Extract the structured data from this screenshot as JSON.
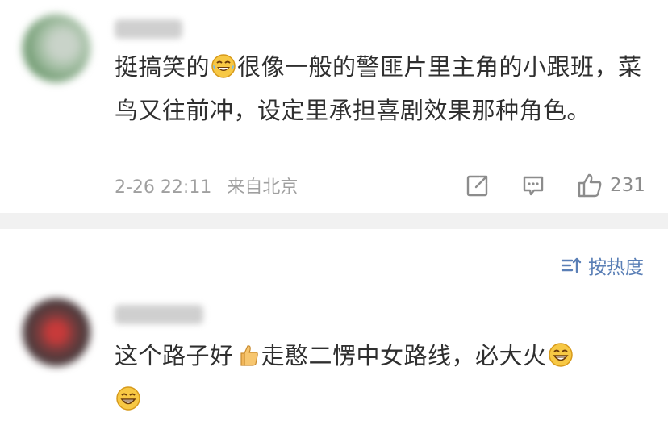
{
  "comments": [
    {
      "text_a": "挺搞笑的",
      "emoji_a": "laughing-tears-emoji",
      "text_b": "很像一般的警匪片里主角的小跟班，菜鸟又往前冲，设定里承担喜剧效果那种角色。",
      "date": "2-26 22:11",
      "location": "来自北京",
      "like_count": "231"
    },
    {
      "text_a": "这个路子好",
      "emoji_a": "thumbs-up-emoji",
      "text_b": "走憨二愣中女路线，必大火",
      "emoji_b": "grinning-emoji",
      "emoji_c": "grinning-emoji"
    }
  ],
  "sort": {
    "label": "按热度"
  },
  "colors": {
    "text": "#2f2f2f",
    "meta": "#a0a0a0",
    "accent": "#5a7fb6",
    "divider": "#f1f1f1"
  }
}
